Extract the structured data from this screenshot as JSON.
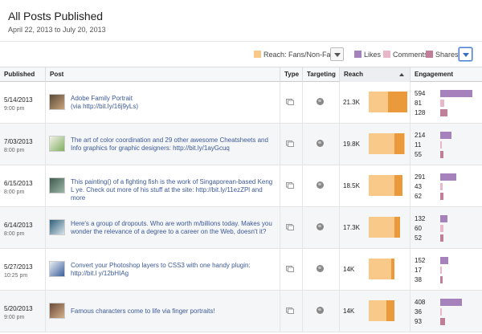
{
  "header": {
    "title": "All Posts Published",
    "date_range": "April 22, 2013 to July 20, 2013"
  },
  "legend": {
    "reach_label": "Reach: Fans/Non-Fans",
    "likes_label": "Likes",
    "comments_label": "Comments",
    "shares_label": "Shares",
    "colors": {
      "fans": "#f8c989",
      "non_fans": "#ea9a3b",
      "likes": "#a682bd",
      "comments": "#e8b7c9",
      "shares": "#c07e99"
    }
  },
  "columns": {
    "published": "Published",
    "post": "Post",
    "type": "Type",
    "targeting": "Targeting",
    "reach": "Reach",
    "engagement": "Engagement"
  },
  "rows": [
    {
      "date": "5/14/2013",
      "time": "9:00 pm",
      "text": "Adobe Family Portrait\n(via http://bit.ly/16j9yLs)",
      "reach": "21.3K",
      "reach_ratio": 1.0,
      "nonfans_fraction": 0.5,
      "likes": "594",
      "comments": "81",
      "shares": "128",
      "thumb_colors": [
        "#5a4a3a",
        "#c9a57a"
      ]
    },
    {
      "date": "7/03/2013",
      "time": "8:00 pm",
      "text": "The art of color coordination and 29 other awesome Cheatsheets and Info graphics for graphic designers: http://bit.ly/1ayGcuq",
      "reach": "19.8K",
      "reach_ratio": 0.93,
      "nonfans_fraction": 0.28,
      "likes": "214",
      "comments": "11",
      "shares": "55",
      "thumb_colors": [
        "#f2f2e8",
        "#7fae5e"
      ]
    },
    {
      "date": "6/15/2013",
      "time": "8:00 pm",
      "text": "This painting() of a fighting fish is the work of Singaporean-based Keng L ye. Check out more of his stuff at the site: http://bit.ly/11ezZPl and more",
      "reach": "18.5K",
      "reach_ratio": 0.87,
      "nonfans_fraction": 0.24,
      "likes": "291",
      "comments": "43",
      "shares": "62",
      "thumb_colors": [
        "#3f5a4f",
        "#9db8a8"
      ]
    },
    {
      "date": "6/14/2013",
      "time": "8:00 pm",
      "text": "Here's a group of dropouts. Who are worth m/billions today. Makes you wonder the relevance of a degree to a career on the Web, doesn't it?",
      "reach": "17.3K",
      "reach_ratio": 0.81,
      "nonfans_fraction": 0.18,
      "likes": "132",
      "comments": "60",
      "shares": "52",
      "thumb_colors": [
        "#2e5f7a",
        "#d9e4ea"
      ]
    },
    {
      "date": "5/27/2013",
      "time": "10:25 pm",
      "text": "Convert your Photoshop layers to CSS3 with one handy plugin: http://bit.l y/12bHIAg",
      "reach": "14K",
      "reach_ratio": 0.66,
      "nonfans_fraction": 0.12,
      "likes": "152",
      "comments": "17",
      "shares": "38",
      "thumb_colors": [
        "#e8eef4",
        "#3b5e9a"
      ]
    },
    {
      "date": "5/20/2013",
      "time": "9:00 pm",
      "text": "Famous characters come to life via finger portraits!",
      "reach": "14K",
      "reach_ratio": 0.66,
      "nonfans_fraction": 0.3,
      "likes": "408",
      "comments": "36",
      "shares": "93",
      "thumb_colors": [
        "#6a4a3a",
        "#d4b08a"
      ]
    }
  ]
}
